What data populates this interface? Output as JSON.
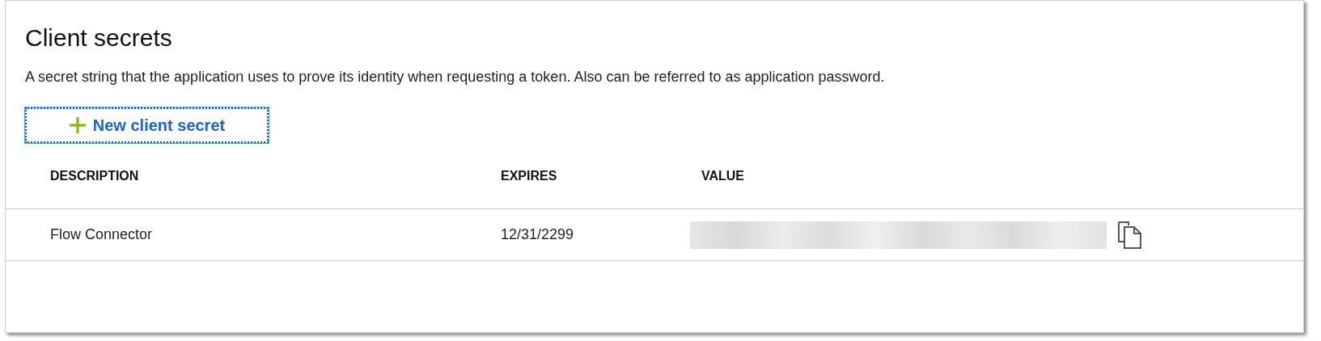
{
  "title": "Client secrets",
  "description": "A secret string that the application uses to prove its identity when requesting a token. Also can be referred to as application password.",
  "new_button": {
    "label": "New client secret",
    "focused": true
  },
  "table": {
    "columns": [
      "DESCRIPTION",
      "EXPIRES",
      "VALUE"
    ],
    "rows": [
      {
        "description": "Flow Connector",
        "expires": "12/31/2299",
        "value": {
          "kind": "redacted"
        }
      }
    ]
  }
}
